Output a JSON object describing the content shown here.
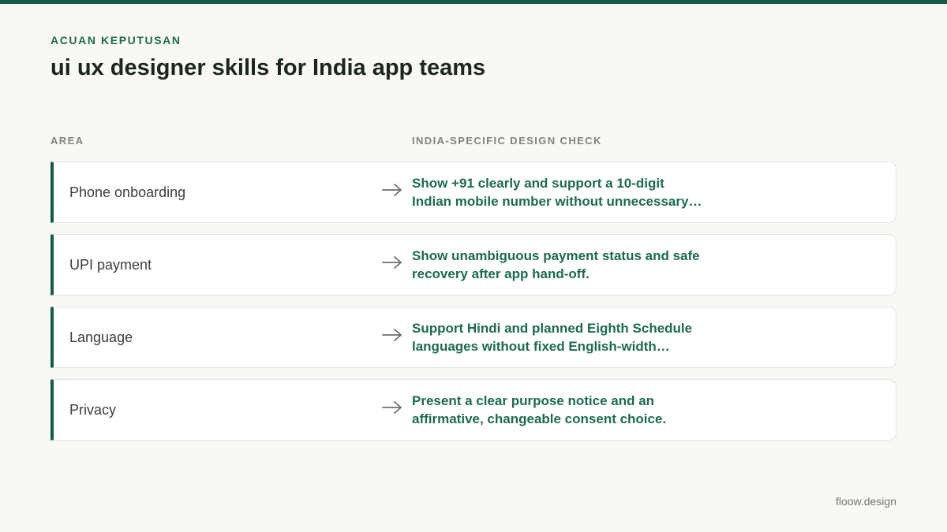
{
  "eyebrow": "ACUAN KEPUTUSAN",
  "title": "ui ux designer skills for India app teams",
  "columns": {
    "area": "AREA",
    "check": "INDIA-SPECIFIC DESIGN CHECK"
  },
  "rows": [
    {
      "area": "Phone onboarding",
      "check_line1": "Show +91 clearly and support a 10-digit",
      "check_line2": "Indian mobile number without unnecessary…"
    },
    {
      "area": "UPI payment",
      "check_line1": "Show unambiguous payment status and safe",
      "check_line2": "recovery after app hand-off."
    },
    {
      "area": "Language",
      "check_line1": "Support Hindi and planned Eighth Schedule",
      "check_line2": "languages without fixed English-width…"
    },
    {
      "area": "Privacy",
      "check_line1": "Present a clear purpose notice and an",
      "check_line2": "affirmative, changeable consent choice."
    }
  ],
  "arrow_icon": "arrow-right-icon",
  "brand": "floow.design",
  "colors": {
    "accent": "#165b45",
    "accent_text": "#1d6a4f",
    "background": "#f9f8f4",
    "card": "#ffffff"
  }
}
